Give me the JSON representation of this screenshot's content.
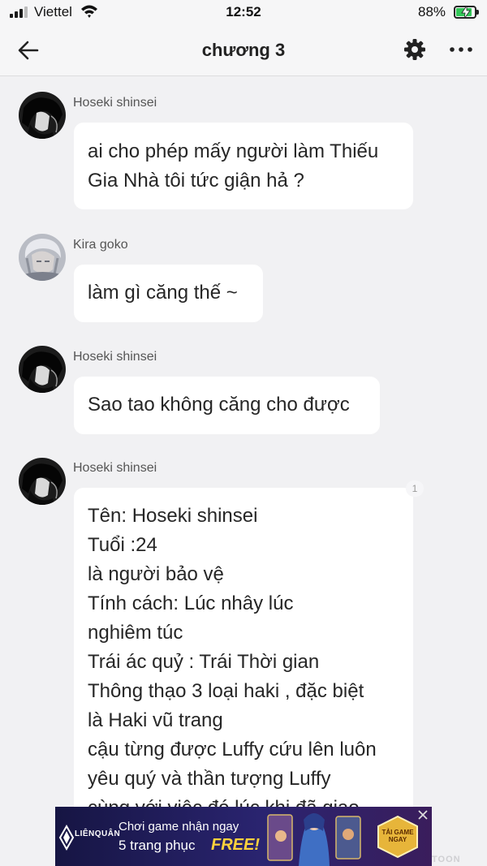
{
  "status_bar": {
    "carrier": "Viettel",
    "time": "12:52",
    "battery_percent": "88%",
    "battery_level": 0.88,
    "icons": [
      "signal-icon",
      "wifi-icon",
      "battery-charging-icon"
    ]
  },
  "header": {
    "title": "chương 3",
    "icons": [
      "back-arrow-icon",
      "gear-icon",
      "more-dots-icon"
    ]
  },
  "messages": [
    {
      "sender": "Hoseki shinsei",
      "lines": [
        "ai cho phép mấy người làm Thiếu",
        "Gia Nhà tôi tức giận hả ?"
      ]
    },
    {
      "sender": "Kira goko",
      "lines": [
        "làm gì căng thế ~"
      ]
    },
    {
      "sender": "Hoseki shinsei",
      "lines": [
        "Sao tao không căng cho được"
      ]
    },
    {
      "sender": "Hoseki shinsei",
      "reply_count": "1",
      "lines": [
        "Tên: Hoseki shinsei",
        "Tuổi :24",
        "là người bảo vệ",
        "Tính cách: Lúc nhây lúc",
        "nghiêm túc",
        "Trái ác quỷ : Trái Thời gian",
        "Thông thạo 3 loại haki , đặc biệt",
        "là Haki vũ trang",
        "cậu từng được Luffy cứu lên luôn",
        "yêu quý và thần tượng Luffy",
        "cùng với việc đó lúc khi đã giao"
      ]
    }
  ],
  "ad": {
    "brand": "LIÊNQUÂN",
    "line1": "Chơi game nhận ngay",
    "line2": "5 trang phục",
    "highlight": "FREE!",
    "cta": "TẢI GAME NGAY",
    "colors": {
      "background": "#1c1b4a",
      "highlight": "#ffd23c",
      "cta": "#e7b53a"
    }
  },
  "watermark": "TOON",
  "colors": {
    "background": "#f1f1f3",
    "bubble": "#ffffff",
    "text": "#262626",
    "sender": "#555555"
  }
}
